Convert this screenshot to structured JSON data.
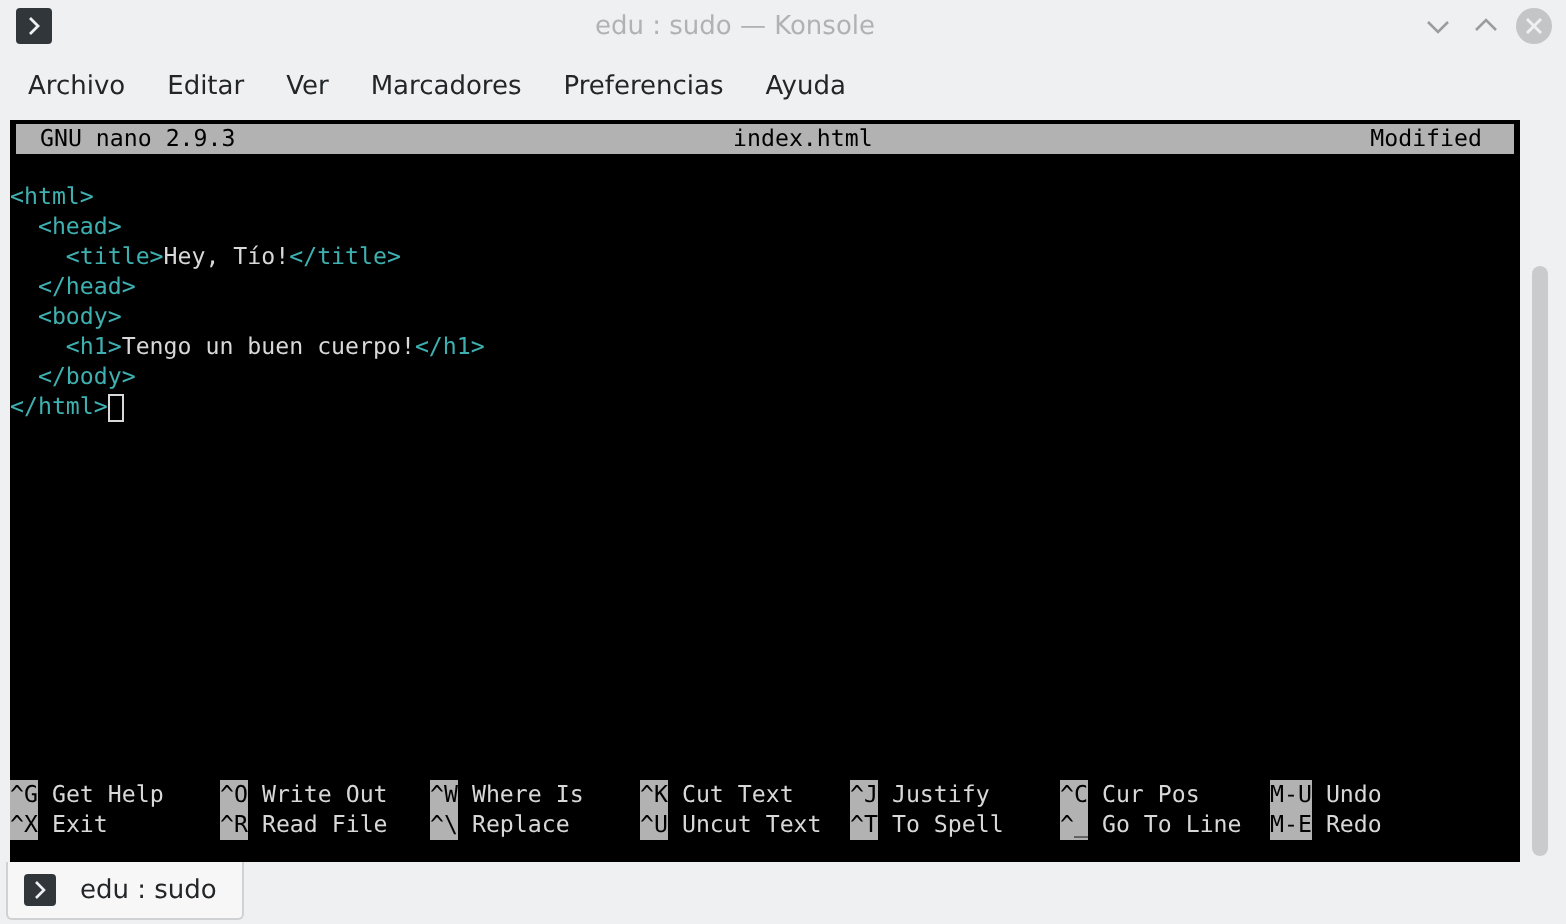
{
  "window": {
    "title": "edu : sudo — Konsole"
  },
  "menu": [
    "Archivo",
    "Editar",
    "Ver",
    "Marcadores",
    "Preferencias",
    "Ayuda"
  ],
  "nano": {
    "version": "GNU nano 2.9.3",
    "filename": "index.html",
    "status": "Modified"
  },
  "code_lines": [
    {
      "cursor": false,
      "segments": [
        {
          "kind": "tag",
          "text": "<html>"
        }
      ]
    },
    {
      "cursor": false,
      "segments": [
        {
          "kind": "tag",
          "text": "  <head>"
        }
      ]
    },
    {
      "cursor": false,
      "segments": [
        {
          "kind": "tag",
          "text": "    <title>"
        },
        {
          "kind": "text",
          "text": "Hey, Tío!"
        },
        {
          "kind": "tag",
          "text": "</title>"
        }
      ]
    },
    {
      "cursor": false,
      "segments": [
        {
          "kind": "tag",
          "text": "  </head>"
        }
      ]
    },
    {
      "cursor": false,
      "segments": [
        {
          "kind": "tag",
          "text": "  <body>"
        }
      ]
    },
    {
      "cursor": false,
      "segments": [
        {
          "kind": "tag",
          "text": "    <h1>"
        },
        {
          "kind": "text",
          "text": "Tengo un buen cuerpo!"
        },
        {
          "kind": "tag",
          "text": "</h1>"
        }
      ]
    },
    {
      "cursor": false,
      "segments": [
        {
          "kind": "tag",
          "text": "  </body>"
        }
      ]
    },
    {
      "cursor": true,
      "segments": [
        {
          "kind": "tag",
          "text": "</html>"
        }
      ]
    }
  ],
  "shortcuts": [
    {
      "key": "^G",
      "label": "Get Help"
    },
    {
      "key": "^O",
      "label": "Write Out"
    },
    {
      "key": "^W",
      "label": "Where Is"
    },
    {
      "key": "^K",
      "label": "Cut Text"
    },
    {
      "key": "^J",
      "label": "Justify"
    },
    {
      "key": "^C",
      "label": "Cur Pos"
    },
    {
      "key": "M-U",
      "label": "Undo"
    },
    {
      "key": "^X",
      "label": "Exit"
    },
    {
      "key": "^R",
      "label": "Read File"
    },
    {
      "key": "^\\",
      "label": "Replace"
    },
    {
      "key": "^U",
      "label": "Uncut Text"
    },
    {
      "key": "^T",
      "label": "To Spell"
    },
    {
      "key": "^_",
      "label": "Go To Line"
    },
    {
      "key": "M-E",
      "label": "Redo"
    }
  ],
  "tabs": [
    {
      "label": "edu : sudo",
      "selected": true
    }
  ]
}
